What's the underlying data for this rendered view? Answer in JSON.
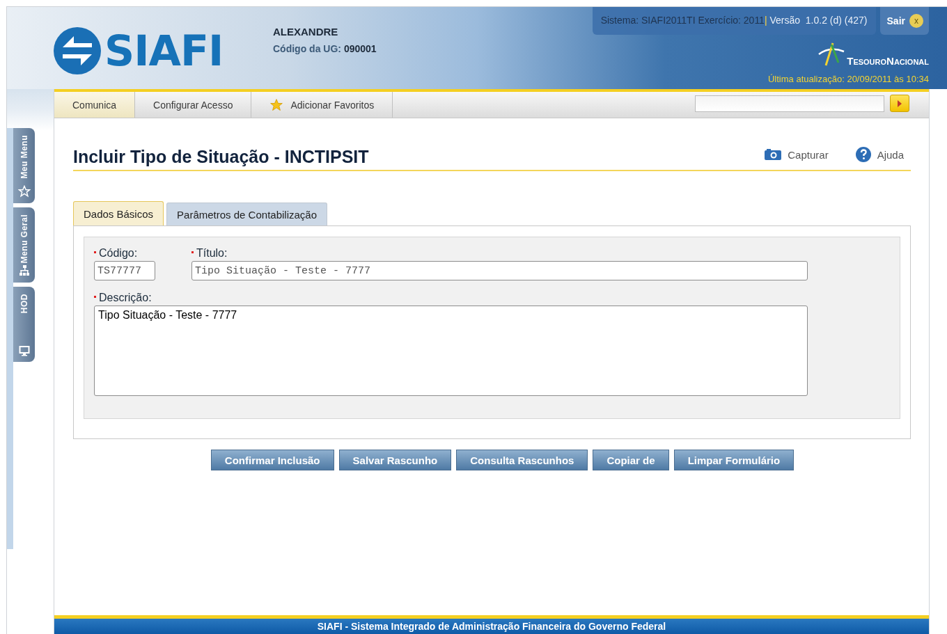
{
  "header": {
    "logo": "SIAFI",
    "user": "ALEXANDRE",
    "ug_label": "Código da UG:",
    "ug_code": "090001",
    "system_info": "Sistema: SIAFI2011TI Exercício: 2011",
    "separator": "|",
    "version": "Versão  1.0.2 (d) (427)",
    "exit": "Sair",
    "exit_mark": "x",
    "brand": "TesouroNacional",
    "last_update": "Última atualização: 20/09/2011 às 10:34"
  },
  "side_tabs": [
    {
      "label": "Meu Menu"
    },
    {
      "label": "Menu Geral"
    },
    {
      "label": "HOD"
    }
  ],
  "toolbar": {
    "items": [
      {
        "label": "Comunica",
        "selected": true
      },
      {
        "label": "Configurar Acesso",
        "selected": false
      },
      {
        "label": "Adicionar Favoritos",
        "selected": false
      }
    ]
  },
  "page": {
    "title": "Incluir Tipo de Situação - INCTIPSIT",
    "actions": [
      "Capturar",
      "Ajuda"
    ],
    "tabs": [
      {
        "label": "Dados Básicos",
        "selected": true
      },
      {
        "label": "Parâmetros de Contabilização",
        "selected": false
      }
    ],
    "fields": [
      {
        "label": "Código:",
        "value": "TS77777",
        "required": true,
        "readonly": true
      },
      {
        "label": "Título:",
        "value": "Tipo Situação - Teste - 7777",
        "required": true,
        "readonly": true
      },
      {
        "label": "Descrição:",
        "value": "Tipo Situação - Teste - 7777",
        "required": true,
        "readonly": false
      }
    ]
  },
  "buttons": [
    "Confirmar Inclusão",
    "Salvar Rascunho",
    "Consulta Rascunhos",
    "Copiar de",
    "Limpar Formulário"
  ],
  "footer": "SIAFI - Sistema Integrado de Administração Financeira do Governo Federal"
}
